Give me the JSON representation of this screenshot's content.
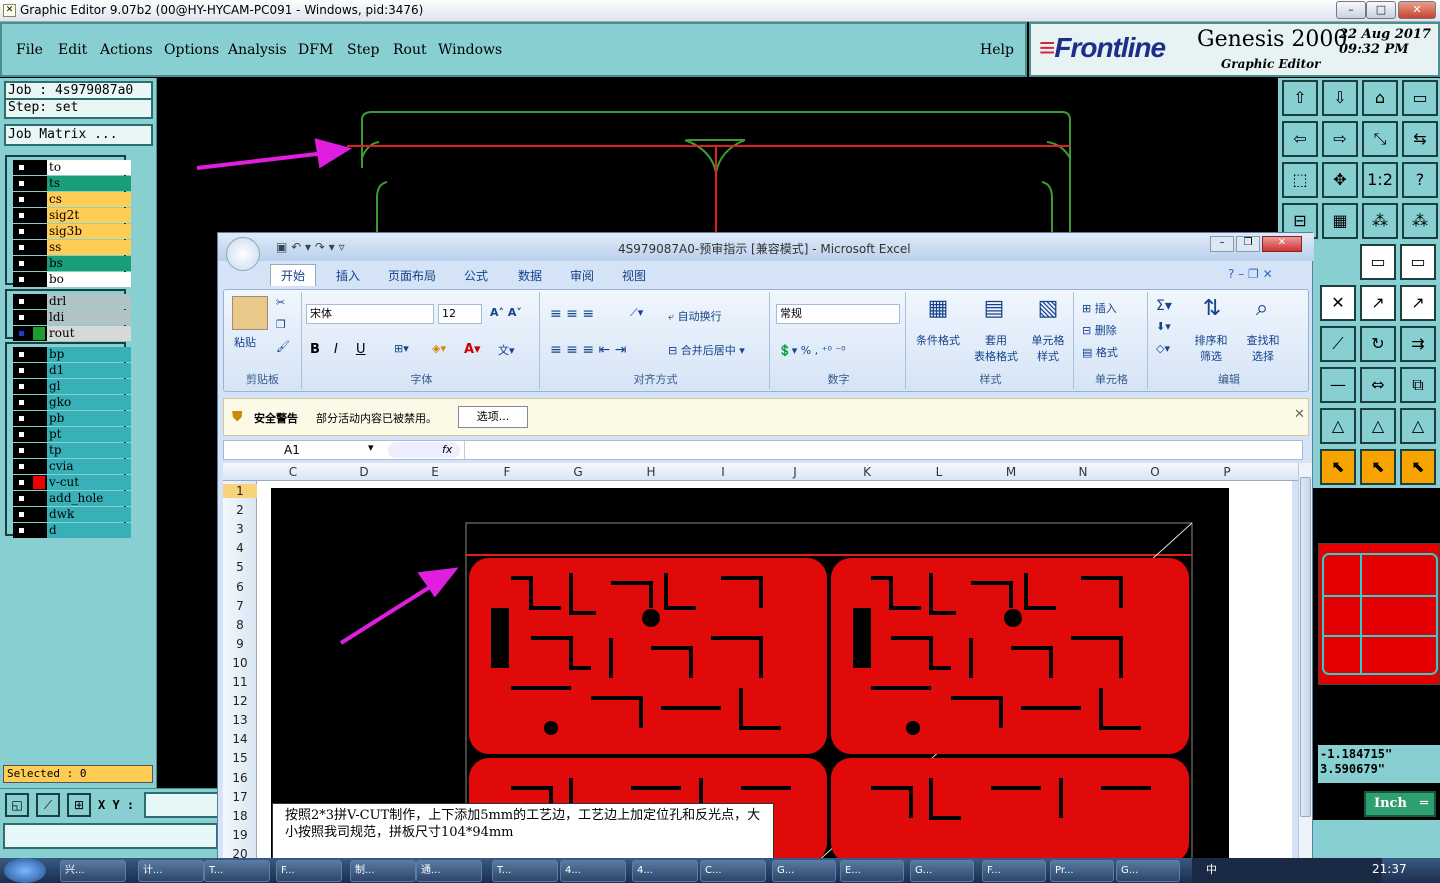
{
  "window": {
    "title": "Graphic Editor 9.07b2 (00@HY-HYCAM-PC091 - Windows, pid:3476)",
    "min": "–",
    "max": "□",
    "close": "✕"
  },
  "menu": [
    "File",
    "Edit",
    "Actions",
    "Options",
    "Analysis",
    "DFM",
    "Step",
    "Rout",
    "Windows"
  ],
  "help": "Help",
  "brand": {
    "logo_a": "≡",
    "logo_b": "Frontline",
    "product": "Genesis 2000",
    "subtitle": "Graphic Editor",
    "date": "22 Aug 2017",
    "time": "09:32 PM"
  },
  "job": {
    "job_label": "Job : 4s979087a0",
    "step_label": "Step: set",
    "matrix": "Job Matrix ..."
  },
  "layers_a": [
    {
      "name": "to",
      "color": "#ffffff"
    },
    {
      "name": "ts",
      "color": "#1a9e7a"
    },
    {
      "name": "cs",
      "color": "#ffcc55"
    },
    {
      "name": "sig2t",
      "color": "#ffcc55"
    },
    {
      "name": "sig3b",
      "color": "#ffcc55"
    },
    {
      "name": "ss",
      "color": "#ffcc55"
    },
    {
      "name": "bs",
      "color": "#1a9e7a"
    },
    {
      "name": "bo",
      "color": "#ffffff"
    }
  ],
  "layers_b": [
    {
      "name": "drl",
      "color": "#b0c4c4"
    },
    {
      "name": "ldi",
      "color": "#b0c4c4"
    },
    {
      "name": "rout",
      "color": "#d8d8d8"
    }
  ],
  "layers_c": [
    {
      "name": "bp",
      "color": "#37b0b8"
    },
    {
      "name": "d1",
      "color": "#37b0b8"
    },
    {
      "name": "gl",
      "color": "#37b0b8"
    },
    {
      "name": "gko",
      "color": "#37b0b8"
    },
    {
      "name": "pb",
      "color": "#37b0b8"
    },
    {
      "name": "pt",
      "color": "#37b0b8"
    },
    {
      "name": "tp",
      "color": "#37b0b8"
    },
    {
      "name": "cvia",
      "color": "#37b0b8"
    },
    {
      "name": "v-cut",
      "color": "#37b0b8"
    },
    {
      "name": "add_hole",
      "color": "#37b0b8"
    },
    {
      "name": "dwk",
      "color": "#37b0b8"
    },
    {
      "name": "d",
      "color": "#37b0b8"
    }
  ],
  "selected": "Selected : 0",
  "xy_label": "X Y :",
  "coords": {
    "x": "-1.184715\"",
    "y": "3.590679\""
  },
  "units": "Inch",
  "excel": {
    "title": "4S979087A0-预审指示 [兼容模式] - Microsoft Excel",
    "tabs": [
      "开始",
      "插入",
      "页面布局",
      "公式",
      "数据",
      "审阅",
      "视图"
    ],
    "font": "宋体",
    "size": "12",
    "numfmt": "常规",
    "wrap": "自动换行",
    "merge": "合并后居中",
    "groups": [
      "剪贴板",
      "字体",
      "对齐方式",
      "数字",
      "样式",
      "单元格",
      "编辑"
    ],
    "paste": "粘贴",
    "styles": [
      "条件格式",
      "套用\n表格格式",
      "单元格\n样式"
    ],
    "cells": [
      "插入",
      "删除",
      "格式"
    ],
    "edit": [
      "排序和\n筛选",
      "查找和\n选择"
    ],
    "sec_title": "安全警告",
    "sec_msg": "部分活动内容已被禁用。",
    "sec_btn": "选项...",
    "namebox": "A1",
    "fx": "fx",
    "cols": [
      "C",
      "D",
      "E",
      "F",
      "G",
      "H",
      "I",
      "J",
      "K",
      "L",
      "M",
      "N",
      "O",
      "P"
    ],
    "rows": [
      "1",
      "2",
      "3",
      "4",
      "5",
      "6",
      "7",
      "8",
      "9",
      "10",
      "11",
      "12",
      "13",
      "14",
      "15",
      "16",
      "17",
      "18",
      "19",
      "20"
    ],
    "note": "按照2*3拼V-CUT制作，上下添加5mm的工艺边，工艺边上加定位孔和反光点，大小按照我司规范，拼板尺寸104*94mm"
  },
  "taskbar": [
    "兴...",
    "计...",
    "T...",
    "F...",
    "制...",
    "通...",
    "T...",
    "4...",
    "4...",
    "C...",
    "G...",
    "E...",
    "G...",
    "F...",
    "Pr...",
    "G..."
  ],
  "clock": "21:37",
  "ime": "中"
}
